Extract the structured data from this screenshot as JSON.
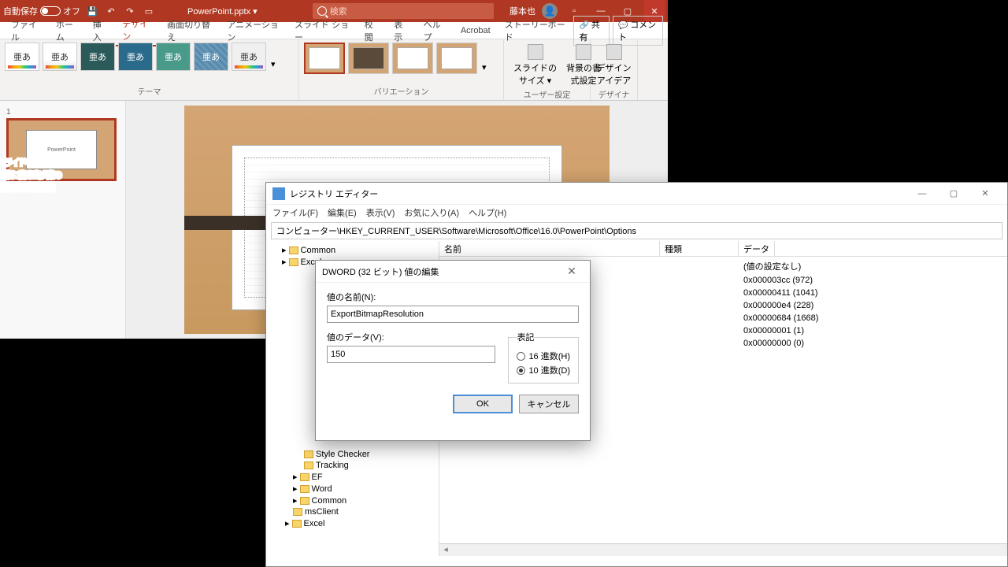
{
  "ppt": {
    "autosave_label": "自動保存",
    "autosave_state": "オフ",
    "doc_title": "PowerPoint.pptx ▾",
    "search_placeholder": "検索",
    "user_name": "藤本也",
    "tabs": [
      "ファイル",
      "ホーム",
      "挿入",
      "デザイン",
      "画面切り替え",
      "アニメーション",
      "スライド ショー",
      "校閲",
      "表示",
      "ヘルプ",
      "Acrobat",
      "ストーリーボード"
    ],
    "active_tab": "デザイン",
    "share": "共有",
    "comment": "コメント",
    "theme_label": "亜あ",
    "group_themes": "テーマ",
    "group_variations": "バリエーション",
    "group_usersettings": "ユーザー設定",
    "group_designer": "デザイナー",
    "btn_slidesize": "スライドの\nサイズ ▾",
    "btn_bgformat": "背景の書\n式設定",
    "btn_designideas": "デザイン\nアイデア",
    "slide_number": "1",
    "thumb_text": "PowerPoint"
  },
  "regedit": {
    "title": "レジストリ エディター",
    "menus": [
      "ファイル(F)",
      "編集(E)",
      "表示(V)",
      "お気に入り(A)",
      "ヘルプ(H)"
    ],
    "address": "コンピューター\\HKEY_CURRENT_USER\\Software\\Microsoft\\Office\\16.0\\PowerPoint\\Options",
    "cols": [
      "名前",
      "種類",
      "データ"
    ],
    "tree": [
      "Common",
      "Excel",
      "Style Checker",
      "Tracking",
      "EF",
      "Word",
      "Common",
      "msClient",
      "Excel"
    ],
    "rows": [
      {
        "data": "(値の設定なし)"
      },
      {
        "data": "0x000003cc (972)"
      },
      {
        "data": "0x00000411 (1041)"
      },
      {
        "data": "0x000000e4 (228)"
      },
      {
        "data": "0x00000684 (1668)"
      },
      {
        "data": "0x00000001 (1)"
      },
      {
        "data": "0x00000000 (0)"
      }
    ]
  },
  "dword": {
    "title": "DWORD (32 ビット) 値の編集",
    "name_label": "値の名前(N):",
    "name_value": "ExportBitmapResolution",
    "value_label": "値のデータ(V):",
    "value_data": "150",
    "base_label": "表記",
    "radio_hex": "16 進数(H)",
    "radio_dec": "10 進数(D)",
    "ok": "OK",
    "cancel": "キャンセル"
  },
  "overlay": {
    "line1": "スライドを",
    "line2": "画像に書き出す際の",
    "line3": "解像度の変更方法"
  }
}
